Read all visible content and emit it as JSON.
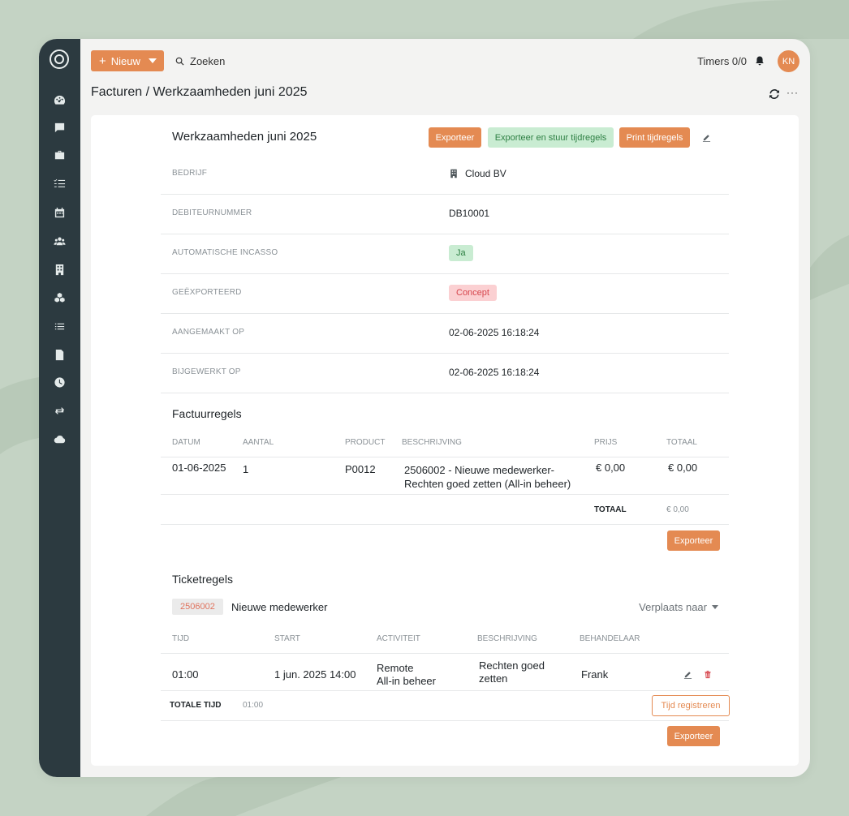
{
  "topbar": {
    "new_label": "Nieuw",
    "search_label": "Zoeken",
    "timers": "Timers 0/0",
    "avatar": "KN"
  },
  "breadcrumb": "Facturen / Werkzaamheden juni 2025",
  "card": {
    "title": "Werkzaamheden juni 2025",
    "buttons": {
      "export": "Exporteer",
      "export_send": "Exporteer en stuur tijdregels",
      "print": "Print tijdregels"
    }
  },
  "details": [
    {
      "label": "BEDRIJF",
      "value": "Cloud BV"
    },
    {
      "label": "DEBITEURNUMMER",
      "value": "DB10001"
    },
    {
      "label": "AUTOMATISCHE INCASSO",
      "value": "Ja"
    },
    {
      "label": "GEËXPORTEERD",
      "value": "Concept"
    },
    {
      "label": "AANGEMAAKT OP",
      "value": "02-06-2025 16:18:24"
    },
    {
      "label": "BIJGEWERKT OP",
      "value": "02-06-2025 16:18:24"
    }
  ],
  "invoice_lines": {
    "title": "Factuurregels",
    "headers": [
      "DATUM",
      "AANTAL",
      "PRODUCT",
      "BESCHRIJVING",
      "PRIJS",
      "TOTAAL"
    ],
    "rows": [
      {
        "date": "01-06-2025",
        "qty": "1",
        "product": "P0012",
        "description": "2506002 - Nieuwe medewerker-\nRechten goed zetten (All-in beheer)",
        "price": "€ 0,00",
        "total": "€ 0,00"
      }
    ],
    "total_label": "TOTAAL",
    "total_value": "€ 0,00",
    "export_label": "Exporteer"
  },
  "ticket_lines": {
    "title": "Ticketregels",
    "ticket_id": "2506002",
    "ticket_name": "Nieuwe medewerker",
    "move_to": "Verplaats naar",
    "headers": [
      "TIJD",
      "START",
      "ACTIVITEIT",
      "BESCHRIJVING",
      "BEHANDELAAR"
    ],
    "rows": [
      {
        "time": "01:00",
        "start": "1 jun. 2025 14:00",
        "activity": "Remote\nAll-in beheer",
        "description": "Rechten goed\nzetten",
        "handler": "Frank"
      }
    ],
    "total_time_label": "TOTALE TIJD",
    "total_time_value": "01:00",
    "register_label": "Tijd registreren",
    "export_label": "Exporteer"
  },
  "colors": {
    "accent": "#e48a52",
    "sidebar": "#2c3a40",
    "background": "#c4d3c4",
    "success_bg": "#c9ecd2",
    "danger_bg": "#fbd0d2"
  }
}
